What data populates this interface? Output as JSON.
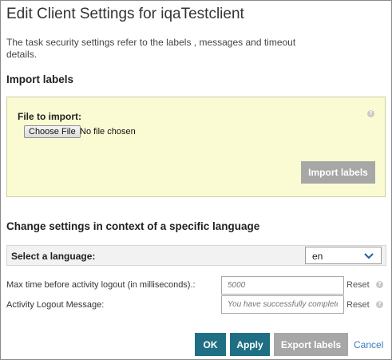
{
  "dialog": {
    "title": "Edit Client Settings for iqaTestclient",
    "description": "The task security settings refer to the labels , messages and timeout details."
  },
  "import": {
    "heading": "Import labels",
    "file_label": "File to import:",
    "choose_button": "Choose File",
    "no_file_text": "No file chosen",
    "help_glyph": "?",
    "import_button": "Import labels"
  },
  "language": {
    "heading": "Change settings in context of a specific language",
    "select_label": "Select a language:",
    "selected": "en"
  },
  "fields": {
    "timeout": {
      "label": "Max time before activity logout (in milliseconds).:",
      "placeholder": "5000",
      "reset": "Reset",
      "help_glyph": "?"
    },
    "message": {
      "label": "Activity Logout Message:",
      "placeholder": "You have successfully completed",
      "reset": "Reset",
      "help_glyph": "?"
    }
  },
  "footer": {
    "ok": "OK",
    "apply": "Apply",
    "export": "Export labels",
    "cancel": "Cancel"
  },
  "colors": {
    "primary": "#1e6f84",
    "disabled": "#a7a7a7",
    "import_bg": "#fbfbd3",
    "link": "#3b7bbf"
  }
}
